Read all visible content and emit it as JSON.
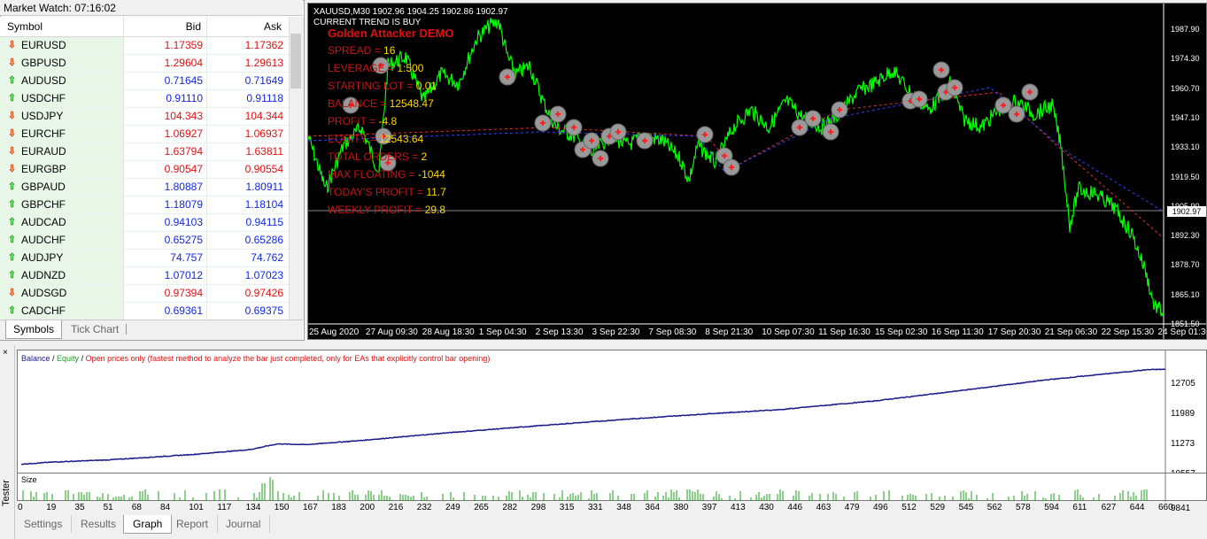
{
  "market_watch": {
    "title": "Market Watch: 07:16:02",
    "close_glyph": "×",
    "columns": [
      "Symbol",
      "Bid",
      "Ask"
    ],
    "rows": [
      {
        "symbol": "EURUSD",
        "bid": "1.17359",
        "ask": "1.17362",
        "dir": "down"
      },
      {
        "symbol": "GBPUSD",
        "bid": "1.29604",
        "ask": "1.29613",
        "dir": "down"
      },
      {
        "symbol": "AUDUSD",
        "bid": "0.71645",
        "ask": "0.71649",
        "dir": "up"
      },
      {
        "symbol": "USDCHF",
        "bid": "0.91110",
        "ask": "0.91118",
        "dir": "up"
      },
      {
        "symbol": "USDJPY",
        "bid": "104.343",
        "ask": "104.344",
        "dir": "down"
      },
      {
        "symbol": "EURCHF",
        "bid": "1.06927",
        "ask": "1.06937",
        "dir": "down"
      },
      {
        "symbol": "EURAUD",
        "bid": "1.63794",
        "ask": "1.63811",
        "dir": "down"
      },
      {
        "symbol": "EURGBP",
        "bid": "0.90547",
        "ask": "0.90554",
        "dir": "down"
      },
      {
        "symbol": "GBPAUD",
        "bid": "1.80887",
        "ask": "1.80911",
        "dir": "up"
      },
      {
        "symbol": "GBPCHF",
        "bid": "1.18079",
        "ask": "1.18104",
        "dir": "up"
      },
      {
        "symbol": "AUDCAD",
        "bid": "0.94103",
        "ask": "0.94115",
        "dir": "up"
      },
      {
        "symbol": "AUDCHF",
        "bid": "0.65275",
        "ask": "0.65286",
        "dir": "up"
      },
      {
        "symbol": "AUDJPY",
        "bid": "74.757",
        "ask": "74.762",
        "dir": "up"
      },
      {
        "symbol": "AUDNZD",
        "bid": "1.07012",
        "ask": "1.07023",
        "dir": "up"
      },
      {
        "symbol": "AUDSGD",
        "bid": "0.97394",
        "ask": "0.97426",
        "dir": "down"
      },
      {
        "symbol": "CADCHF",
        "bid": "0.69361",
        "ask": "0.69375",
        "dir": "up"
      }
    ],
    "tabs": [
      "Symbols",
      "Tick Chart"
    ],
    "colors": {
      "up": "#2aa02a",
      "down": "#d2501e",
      "bid_down": "#e01010",
      "bid_up": "#1028e0"
    }
  },
  "chart": {
    "symbol_line": "XAUUSD,M30  1902.96 1904.25 1902.86 1902.97",
    "trend": "CURRENT TREND IS BUY",
    "ea_title": "Golden Attacker DEMO",
    "stats": [
      {
        "label": "SPREAD = ",
        "value": "16"
      },
      {
        "label": "LEVERAGE = ",
        "value": "1:500"
      },
      {
        "label": "STARTING LOT = ",
        "value": "0.01"
      },
      {
        "label": "BALANCE = ",
        "value": "12548.47"
      },
      {
        "label": "PROFIT = ",
        "value": "-4.8"
      },
      {
        "label": "EQUITY = ",
        "value": "12543.64"
      },
      {
        "label": "TOTAL ORDERS = ",
        "value": "2"
      },
      {
        "label": "MAX FLOATING = ",
        "value": "-1044"
      },
      {
        "label": "TODAY'S PROFIT = ",
        "value": "11.7"
      },
      {
        "label": "WEEKLY PROFIT = ",
        "value": "29.8"
      }
    ],
    "price_ticks": [
      "1987.90",
      "1974.30",
      "1960.70",
      "1947.10",
      "1933.10",
      "1919.50",
      "1905.90",
      "1892.30",
      "1878.70",
      "1865.10",
      "1851.50"
    ],
    "current_price": "1902.97",
    "date_ticks": [
      "25 Aug 2020",
      "27 Aug 09:30",
      "28 Aug 18:30",
      "1 Sep 04:30",
      "2 Sep 13:30",
      "3 Sep 22:30",
      "7 Sep 08:30",
      "8 Sep 21:30",
      "10 Sep 07:30",
      "11 Sep 16:30",
      "15 Sep 02:30",
      "16 Sep 11:30",
      "17 Sep 20:30",
      "21 Sep 06:30",
      "22 Sep 15:30",
      "24 Sep 01:30"
    ],
    "colors": {
      "candles": "#00ff00",
      "bg": "#000000"
    }
  },
  "tester": {
    "label": "Tester",
    "close_glyph": "×",
    "legend": {
      "balance": "Balance",
      "sep1": " / ",
      "equity": "Equity",
      "sep2": " / ",
      "note": "Open prices only (fastest method to analyze the bar just completed, only for EAs that explicitly control bar opening)"
    },
    "y_ticks": [
      "12705",
      "11989",
      "11273",
      "10557",
      "9841"
    ],
    "size_label": "Size",
    "x_ticks": [
      "0",
      "19",
      "35",
      "51",
      "68",
      "84",
      "101",
      "117",
      "134",
      "150",
      "167",
      "183",
      "200",
      "216",
      "232",
      "249",
      "265",
      "282",
      "298",
      "315",
      "331",
      "348",
      "364",
      "380",
      "397",
      "413",
      "430",
      "446",
      "463",
      "479",
      "496",
      "512",
      "529",
      "545",
      "562",
      "578",
      "594",
      "611",
      "627",
      "644",
      "660"
    ],
    "tabs": [
      "Settings",
      "Results",
      "Graph",
      "Report",
      "Journal"
    ],
    "active_tab": "Graph"
  },
  "chart_data": {
    "type": "line",
    "title": "",
    "xlabel": "",
    "ylabel": "",
    "x_range": [
      0,
      670
    ],
    "ylim": [
      9841,
      12705
    ],
    "series": [
      {
        "name": "Balance",
        "x": [
          0,
          19,
          51,
          100,
          134,
          150,
          167,
          200,
          249,
          300,
          350,
          400,
          446,
          463,
          500,
          545,
          600,
          660,
          670
        ],
        "values": [
          9880,
          9940,
          10000,
          10150,
          10290,
          10450,
          10430,
          10550,
          10760,
          10950,
          11130,
          11290,
          11420,
          11500,
          11660,
          11920,
          12250,
          12540,
          12548
        ]
      }
    ]
  }
}
